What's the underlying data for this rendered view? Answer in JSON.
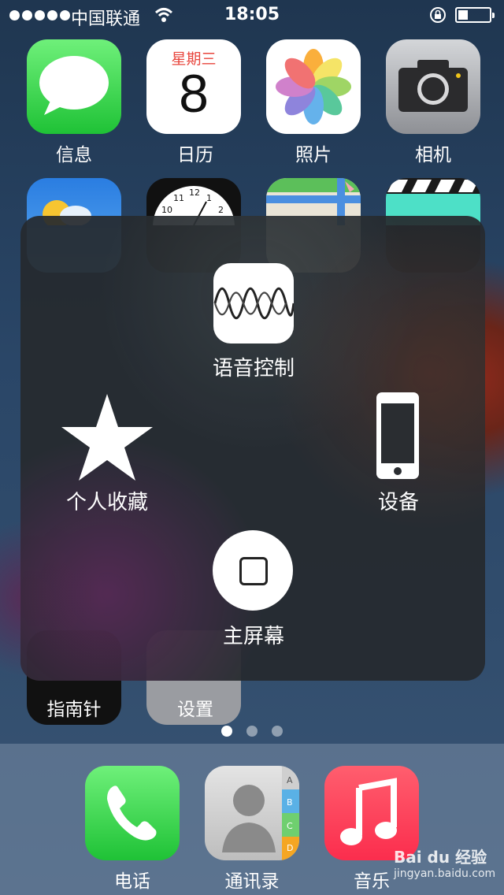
{
  "status_bar": {
    "carrier": "中国联通",
    "time": "18:05"
  },
  "apps_row1": [
    {
      "label": "信息",
      "icon": "messages-icon"
    },
    {
      "label": "日历",
      "icon": "calendar-icon",
      "weekday": "星期三",
      "day": "8"
    },
    {
      "label": "照片",
      "icon": "photos-icon"
    },
    {
      "label": "相机",
      "icon": "camera-icon"
    }
  ],
  "clock_numbers": [
    "11",
    "12",
    "1",
    "10",
    "2"
  ],
  "hidden_labels": {
    "compass": "指南针",
    "settings": "设置"
  },
  "assistive_menu": {
    "voice_control": "语音控制",
    "favorites": "个人收藏",
    "device": "设备",
    "home": "主屏幕"
  },
  "dock": [
    {
      "label": "电话",
      "icon": "phone-icon"
    },
    {
      "label": "通讯录",
      "icon": "contacts-icon",
      "tabs": [
        "A",
        "B",
        "C",
        "D"
      ]
    },
    {
      "label": "音乐",
      "icon": "music-icon"
    }
  ],
  "watermark": {
    "brand": "Bai du 经验",
    "url": "jingyan.baidu.com"
  },
  "colors": {
    "messages": "#4cd964",
    "music": "#fc3d5a",
    "phone": "#4cd964"
  }
}
